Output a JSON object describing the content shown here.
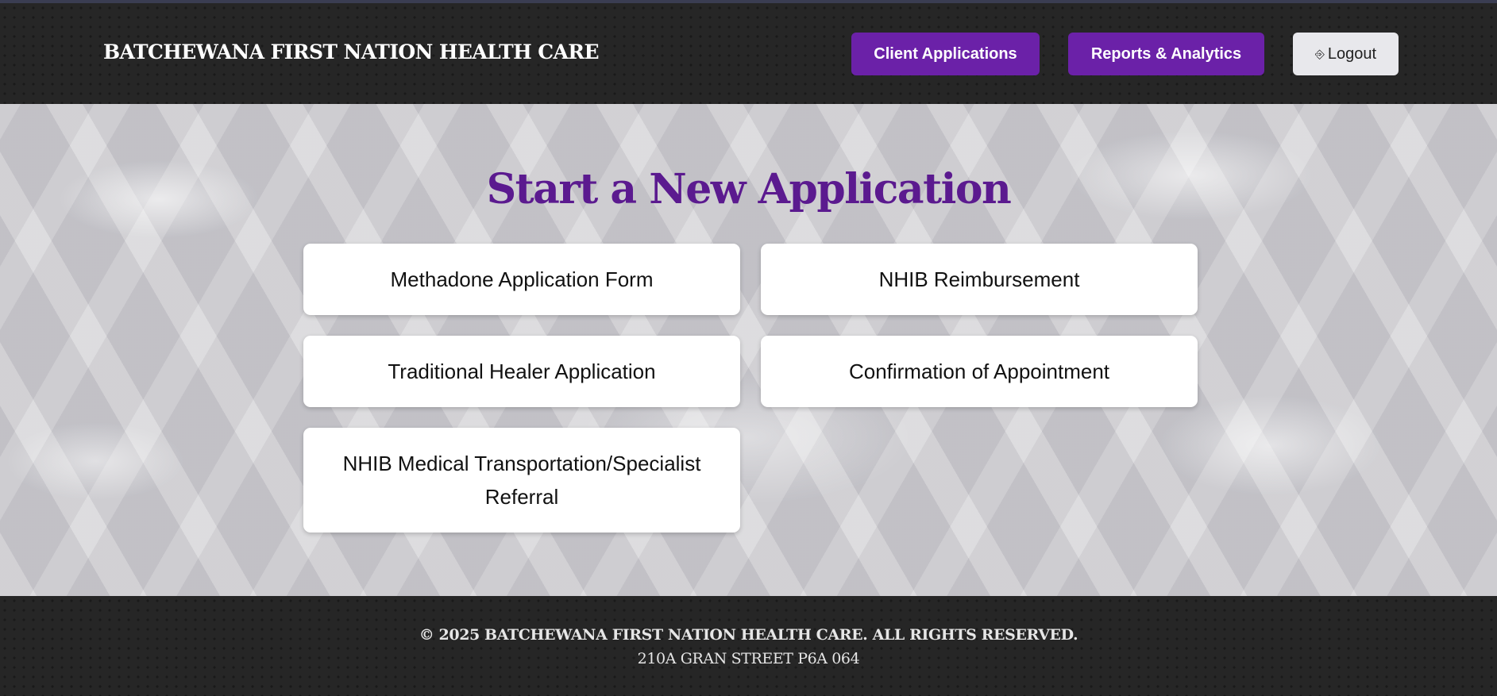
{
  "header": {
    "brand": "BATCHEWANA FIRST NATION HEALTH CARE",
    "nav": {
      "client_applications": "Client Applications",
      "reports_analytics": "Reports & Analytics",
      "logout": "Logout",
      "logout_icon": "⎆"
    }
  },
  "main": {
    "title": "Start a New Application",
    "cards": [
      "Methadone Application Form",
      "NHIB Reimbursement",
      "Traditional Healer Application",
      "Confirmation of Appointment",
      "NHIB Medical Transportation/Specialist Referral"
    ]
  },
  "footer": {
    "copyright": "© 2025 BATCHEWANA FIRST NATION HEALTH CARE. ALL RIGHTS RESERVED.",
    "address": "210A GRAN STREET P6A 064"
  },
  "colors": {
    "accent": "#6b21a8",
    "title": "#5b1a8f",
    "header_bg": "#262626"
  }
}
